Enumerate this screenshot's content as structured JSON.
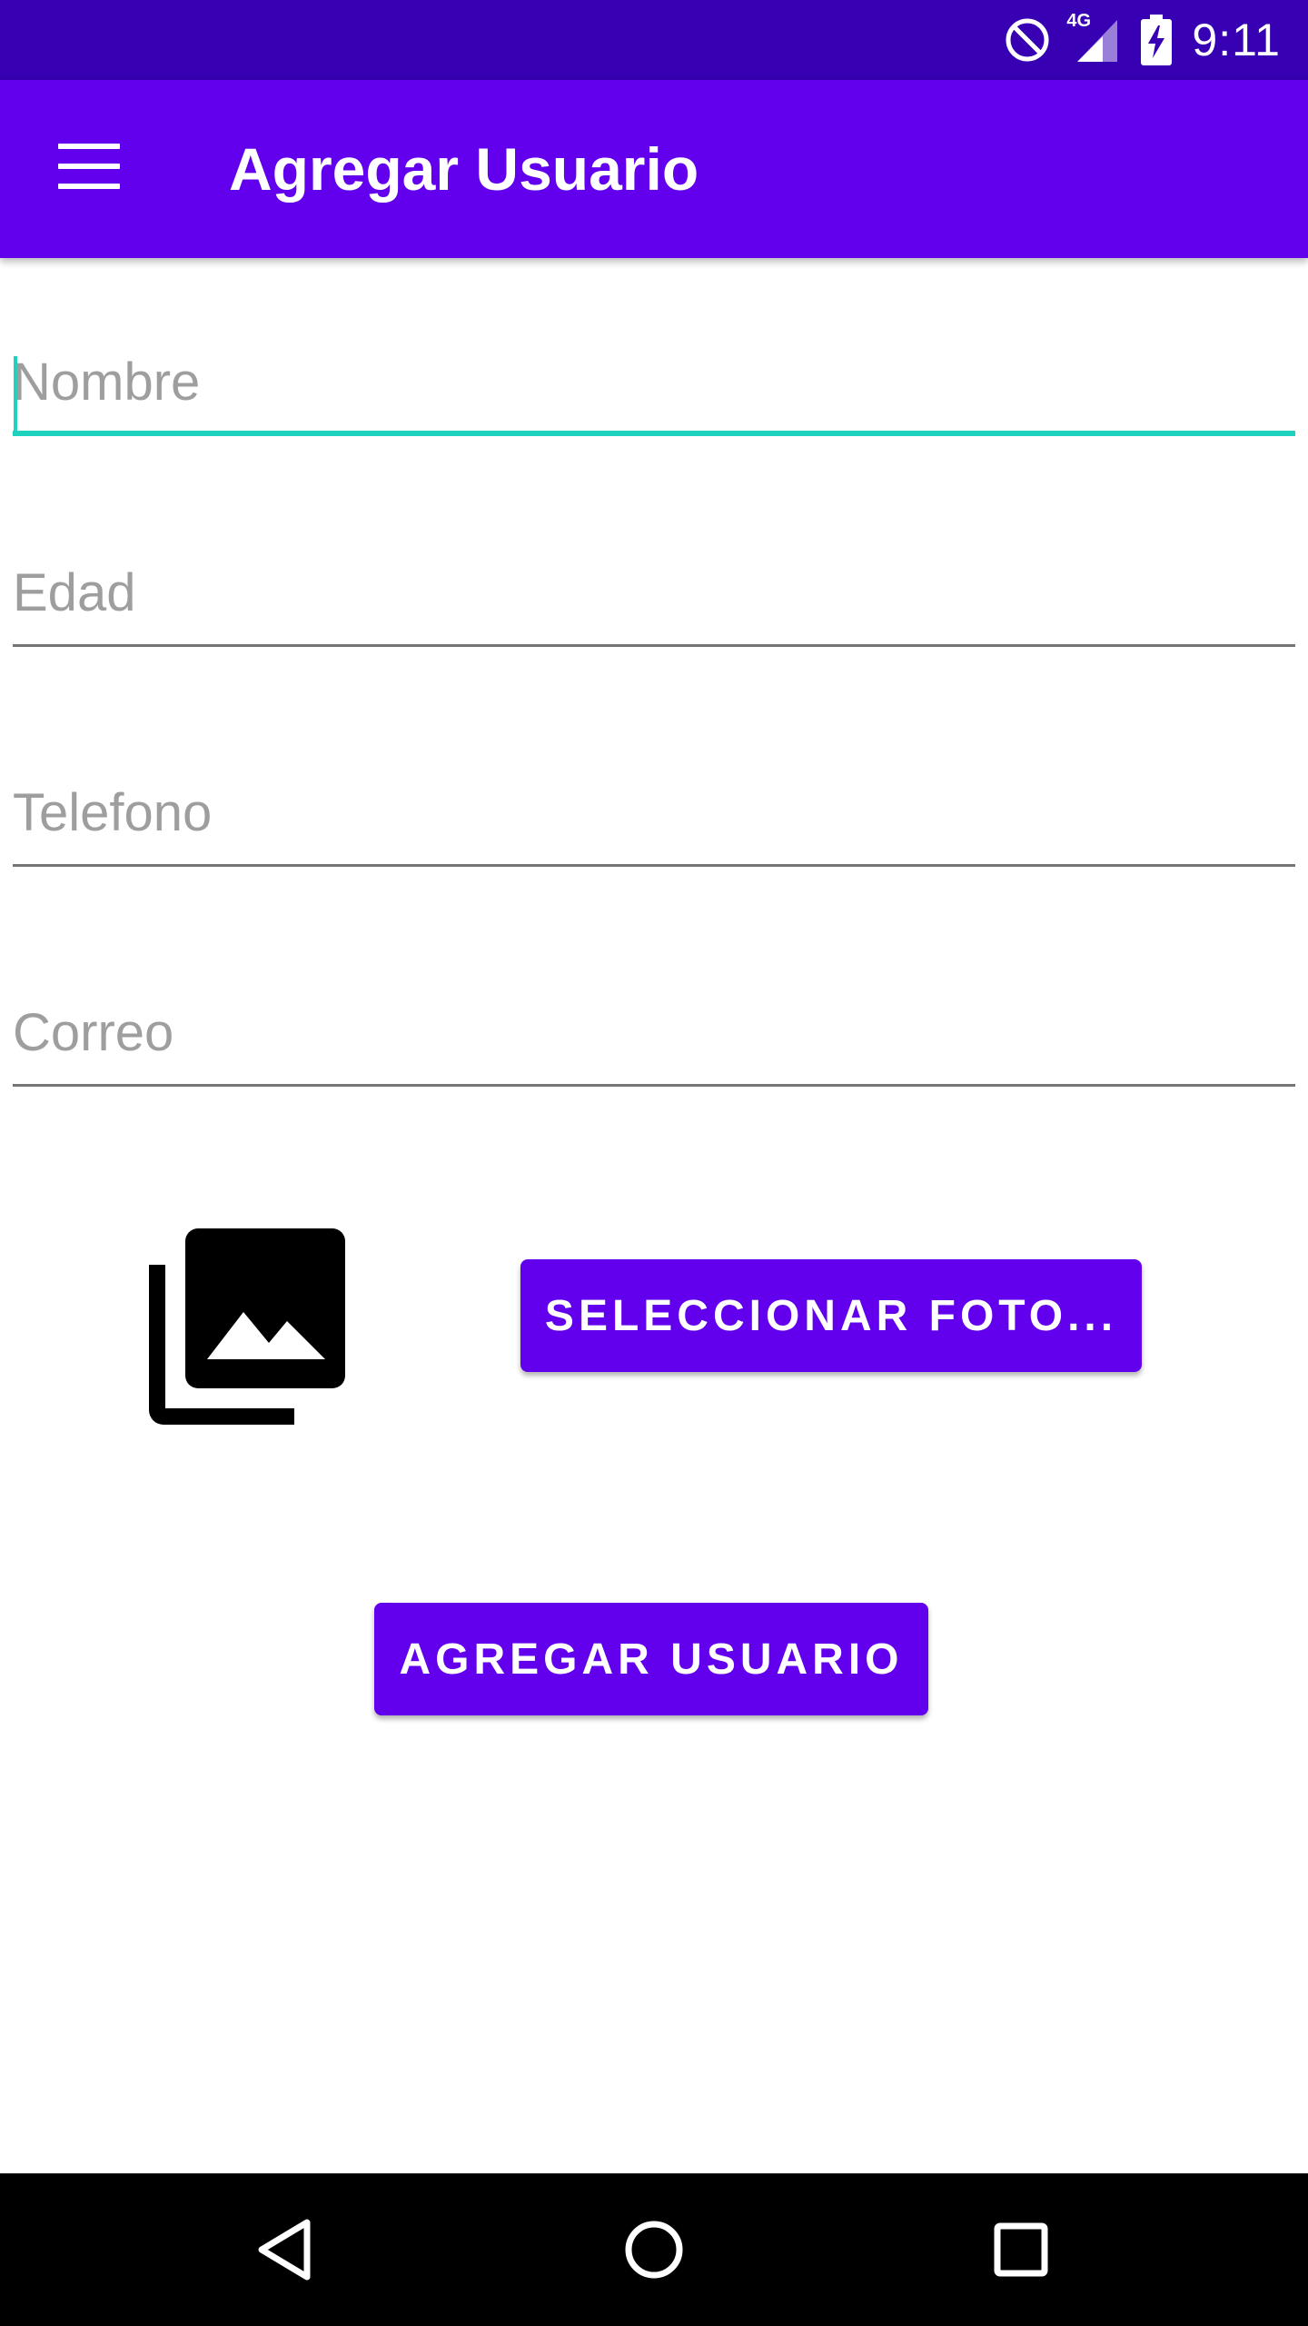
{
  "status_bar": {
    "time": "9:11",
    "network_label": "4G",
    "icons": [
      "do-not-disturb-icon",
      "signal-icon",
      "battery-charging-icon"
    ]
  },
  "app_bar": {
    "menu_icon": "hamburger-menu-icon",
    "title": "Agregar Usuario"
  },
  "form": {
    "fields": [
      {
        "placeholder": "Nombre",
        "value": "",
        "focused": true
      },
      {
        "placeholder": "Edad",
        "value": ""
      },
      {
        "placeholder": "Telefono",
        "value": ""
      },
      {
        "placeholder": "Correo",
        "value": ""
      }
    ],
    "photo_icon": "photo-library-icon",
    "select_photo_label": "SELECCIONAR FOTO...",
    "submit_label": "AGREGAR USUARIO"
  },
  "nav_bar": {
    "icons": [
      "back-icon",
      "home-icon",
      "recents-icon"
    ]
  },
  "colors": {
    "status_bar": "#3700B3",
    "primary": "#6200EE",
    "accent": "#1DD3C0"
  }
}
